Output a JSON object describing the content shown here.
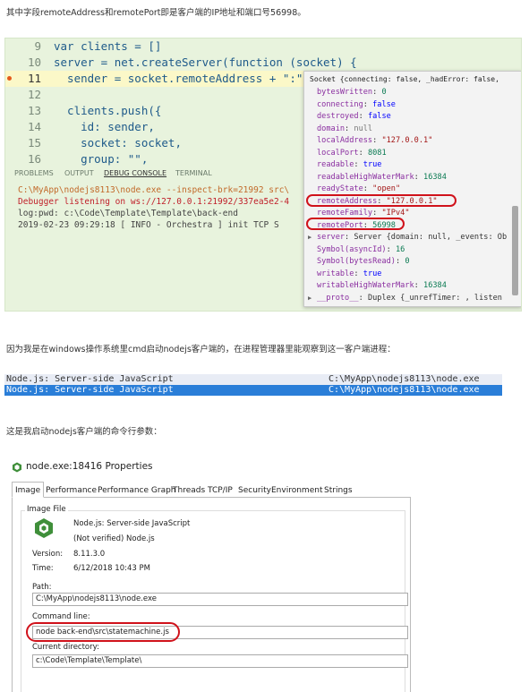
{
  "intro_text": "其中字段remoteAddress和remotePort即是客户端的IP地址和端口号56998。",
  "editor": {
    "lines": [
      {
        "num": "9",
        "code": "var clients = []",
        "current": false,
        "breakpoint": false
      },
      {
        "num": "10",
        "code": "server = net.createServer(function (socket) {",
        "current": false,
        "breakpoint": false
      },
      {
        "num": "11",
        "code": "  sender = socket.remoteAddress + \":\"",
        "current": true,
        "breakpoint": true
      },
      {
        "num": "12",
        "code": "",
        "current": false,
        "breakpoint": false
      },
      {
        "num": "13",
        "code": "  clients.push({",
        "current": false,
        "breakpoint": false
      },
      {
        "num": "14",
        "code": "    id: sender,",
        "current": false,
        "breakpoint": false
      },
      {
        "num": "15",
        "code": "    socket: socket,",
        "current": false,
        "breakpoint": false
      },
      {
        "num": "16",
        "code": "    group: \"\",",
        "current": false,
        "breakpoint": false
      }
    ],
    "panel_tabs": [
      "PROBLEMS",
      "OUTPUT",
      "DEBUG CONSOLE",
      "TERMINAL"
    ],
    "active_panel_tab": "DEBUG CONSOLE",
    "terminal_lines": [
      {
        "text": "C:\\MyApp\\nodejs8113\\node.exe --inspect-brk=21992 src\\",
        "color": "#c26a2a"
      },
      {
        "text": "Debugger listening on ws://127.0.0.1:21992/337ea5e2-4",
        "color": "#c0202a"
      },
      {
        "text": "log:pwd: c:\\Code\\Template\\Template\\back-end",
        "color": "#444444"
      },
      {
        "text": "2019-02-23 09:29:18 [ INFO  -  Orchestra ] init TCP S",
        "color": "#444444"
      }
    ],
    "popup": {
      "header": "Socket {connecting: false, _hadError: false,",
      "props": [
        {
          "key": "bytesWritten",
          "value": "0",
          "kind": "num",
          "expand": false
        },
        {
          "key": "connecting",
          "value": "false",
          "kind": "bool",
          "expand": false
        },
        {
          "key": "destroyed",
          "value": "false",
          "kind": "bool",
          "expand": false
        },
        {
          "key": "domain",
          "value": "null",
          "kind": "null",
          "expand": false
        },
        {
          "key": "localAddress",
          "value": "\"127.0.0.1\"",
          "kind": "str",
          "expand": false
        },
        {
          "key": "localPort",
          "value": "8081",
          "kind": "num",
          "expand": false
        },
        {
          "key": "readable",
          "value": "true",
          "kind": "bool",
          "expand": false
        },
        {
          "key": "readableHighWaterMark",
          "value": "16384",
          "kind": "num",
          "expand": false
        },
        {
          "key": "readyState",
          "value": "\"open\"",
          "kind": "str",
          "expand": false
        },
        {
          "key": "remoteAddress",
          "value": "\"127.0.0.1\"",
          "kind": "str",
          "expand": false
        },
        {
          "key": "remoteFamily",
          "value": "\"IPv4\"",
          "kind": "str",
          "expand": false
        },
        {
          "key": "remotePort",
          "value": "56998",
          "kind": "num",
          "expand": false
        },
        {
          "key": "server",
          "value": "Server {domain: null, _events: Ob",
          "kind": "obj",
          "expand": true
        },
        {
          "key": "Symbol(asyncId)",
          "value": "16",
          "kind": "num",
          "expand": false
        },
        {
          "key": "Symbol(bytesRead)",
          "value": "0",
          "kind": "num",
          "expand": false
        },
        {
          "key": "writable",
          "value": "true",
          "kind": "bool",
          "expand": false
        },
        {
          "key": "writableHighWaterMark",
          "value": "16384",
          "kind": "num",
          "expand": false
        },
        {
          "key": "__proto__",
          "value": "Duplex {_unrefTimer: , listen",
          "kind": "obj",
          "expand": true
        }
      ]
    }
  },
  "text2": "因为我是在windows操作系统里cmd启动nodejs客户端的，在进程管理器里能观察到这一客户端进程：",
  "process_rows": [
    {
      "name": "Node.js: Server-side JavaScript",
      "path": "C:\\MyApp\\nodejs8113\\node.exe"
    },
    {
      "name": "Node.js: Server-side JavaScript",
      "path": "C:\\MyApp\\nodejs8113\\node.exe"
    }
  ],
  "text3": "这是我启动nodejs客户端的命令行参数：",
  "dialog": {
    "title": "node.exe:18416 Properties",
    "tabs": [
      "Image",
      "Performance",
      "Performance Graph",
      "Threads",
      "TCP/IP",
      "Security",
      "Environment",
      "Strings"
    ],
    "active_tab": "Image",
    "group_label": "Image File",
    "app_name": "Node.js: Server-side JavaScript",
    "verified": "(Not verified) Node.js",
    "version_label": "Version:",
    "version": "8.11.3.0",
    "time_label": "Time:",
    "time": "6/12/2018 10:43 PM",
    "path_label": "Path:",
    "path": "C:\\MyApp\\nodejs8113\\node.exe",
    "cmd_label": "Command line:",
    "cmd": "node  back-end\\src\\statemachine.js",
    "cwd_label": "Current directory:",
    "cwd": "c:\\Code\\Template\\Template\\"
  },
  "colors": {
    "editor_bg": "#e8f3dd",
    "highlight_oval": "#d0121b",
    "selected_row": "#2a7ed8"
  }
}
